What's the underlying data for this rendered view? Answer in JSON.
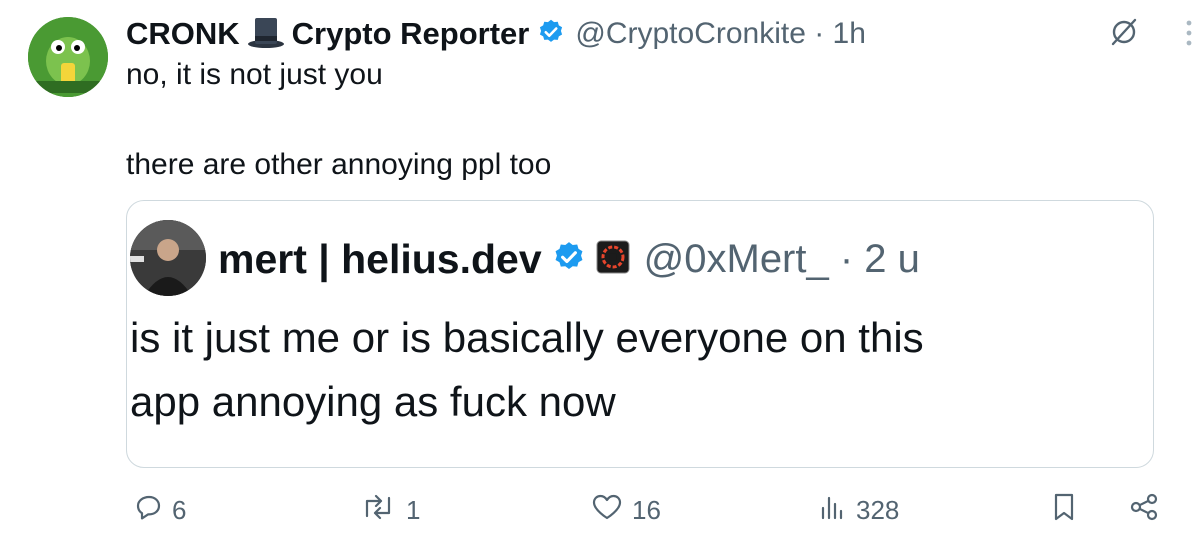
{
  "tweet": {
    "author_name_part1": "CRONK",
    "author_name_part2": "Crypto Reporter",
    "handle_time": "@CryptoCronkite · 1h",
    "text_line1": "no, it is not just you",
    "text_line2": "there are other annoying ppl too"
  },
  "quote": {
    "author_name": "mert | helius.dev",
    "handle_time": "@0xMert_ · 2 u",
    "text_line1": "is it just me or is basically everyone on this",
    "text_line2": "app annoying as fuck now"
  },
  "actions": {
    "replies": "6",
    "reposts": "1",
    "likes": "16",
    "views": "328"
  },
  "colors": {
    "text": "#0f1419",
    "secondary": "#536471",
    "verified": "#1d9bf0",
    "border": "#cfd9de"
  },
  "icons": [
    "top-hat-icon",
    "verified-badge-icon",
    "grok-icon",
    "more-icon",
    "reply-icon",
    "repost-icon",
    "like-icon",
    "views-icon",
    "bookmark-icon",
    "share-icon"
  ]
}
